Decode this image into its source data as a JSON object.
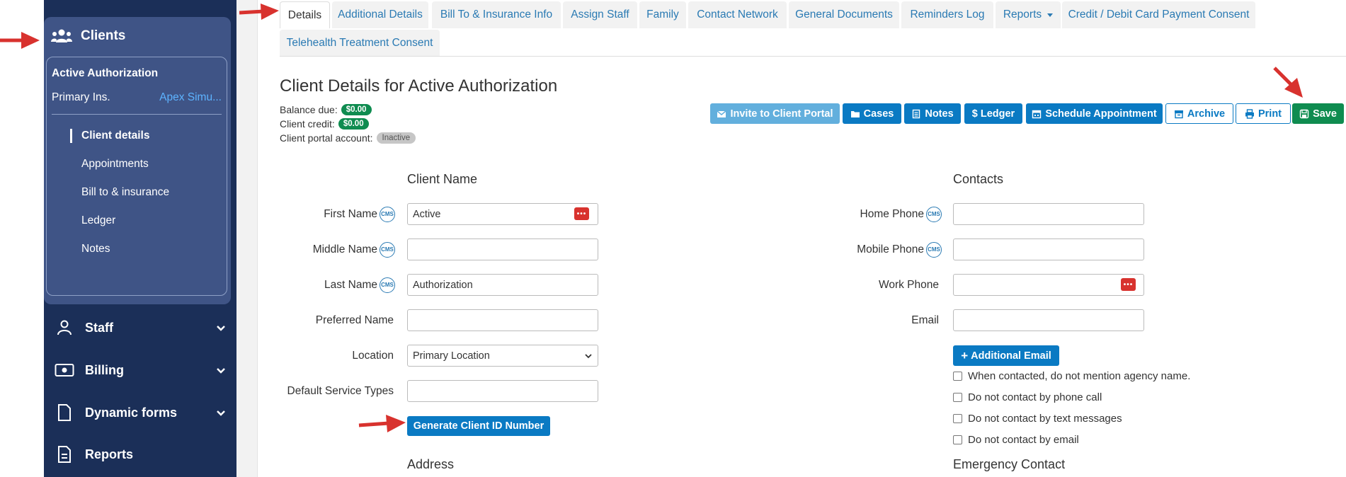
{
  "sidebar": {
    "clients_label": "Clients",
    "authorization_title": "Active Authorization",
    "primary_ins_label": "Primary Ins.",
    "primary_ins_value": "Apex Simu...",
    "sub_items": [
      "Client details",
      "Appointments",
      "Bill to & insurance",
      "Ledger",
      "Notes"
    ],
    "nav": [
      {
        "label": "Staff",
        "icon": "staff-icon"
      },
      {
        "label": "Billing",
        "icon": "billing-icon"
      },
      {
        "label": "Dynamic forms",
        "icon": "document-icon"
      },
      {
        "label": "Reports",
        "icon": "reports-icon"
      }
    ]
  },
  "tabs": {
    "row1": [
      "Details",
      "Additional Details",
      "Bill To & Insurance Info",
      "Assign Staff",
      "Family",
      "Contact Network",
      "General Documents",
      "Reminders Log",
      "Reports",
      "Credit / Debit Card Payment Consent"
    ],
    "row2": [
      "Telehealth Treatment Consent"
    ],
    "active": "Details"
  },
  "header": {
    "title": "Client Details for Active Authorization",
    "balance_label": "Balance due:",
    "balance_value": "$0.00",
    "credit_label": "Client credit:",
    "credit_value": "$0.00",
    "portal_label": "Client portal account:",
    "portal_value": "Inactive"
  },
  "actions": {
    "invite": "Invite to Client Portal",
    "cases": "Cases",
    "notes": "Notes",
    "ledger": "Ledger",
    "schedule": "Schedule Appointment",
    "archive": "Archive",
    "print": "Print",
    "save": "Save"
  },
  "client_name": {
    "section_title": "Client Name",
    "cms_badge": "CMS",
    "first_name_label": "First Name",
    "first_name_value": "Active",
    "middle_name_label": "Middle Name",
    "middle_name_value": "",
    "last_name_label": "Last Name",
    "last_name_value": "Authorization",
    "preferred_name_label": "Preferred Name",
    "preferred_name_value": "",
    "location_label": "Location",
    "location_value": "Primary Location",
    "service_types_label": "Default Service Types",
    "service_types_value": "",
    "generate_button": "Generate Client ID Number",
    "address_title": "Address"
  },
  "contacts": {
    "section_title": "Contacts",
    "home_phone_label": "Home Phone",
    "mobile_phone_label": "Mobile Phone",
    "work_phone_label": "Work Phone",
    "email_label": "Email",
    "additional_email_button": "Additional Email",
    "checkboxes": [
      "When contacted, do not mention agency name.",
      "Do not contact by phone call",
      "Do not contact by text messages",
      "Do not contact by email"
    ],
    "emergency_title": "Emergency Contact"
  },
  "colors": {
    "sidebar_bg": "#1b2f58",
    "sidebar_panel": "#3f5486",
    "primary_blue": "#0a7ac3",
    "success_green": "#0f8c50",
    "annotation_red": "#d8322e"
  }
}
